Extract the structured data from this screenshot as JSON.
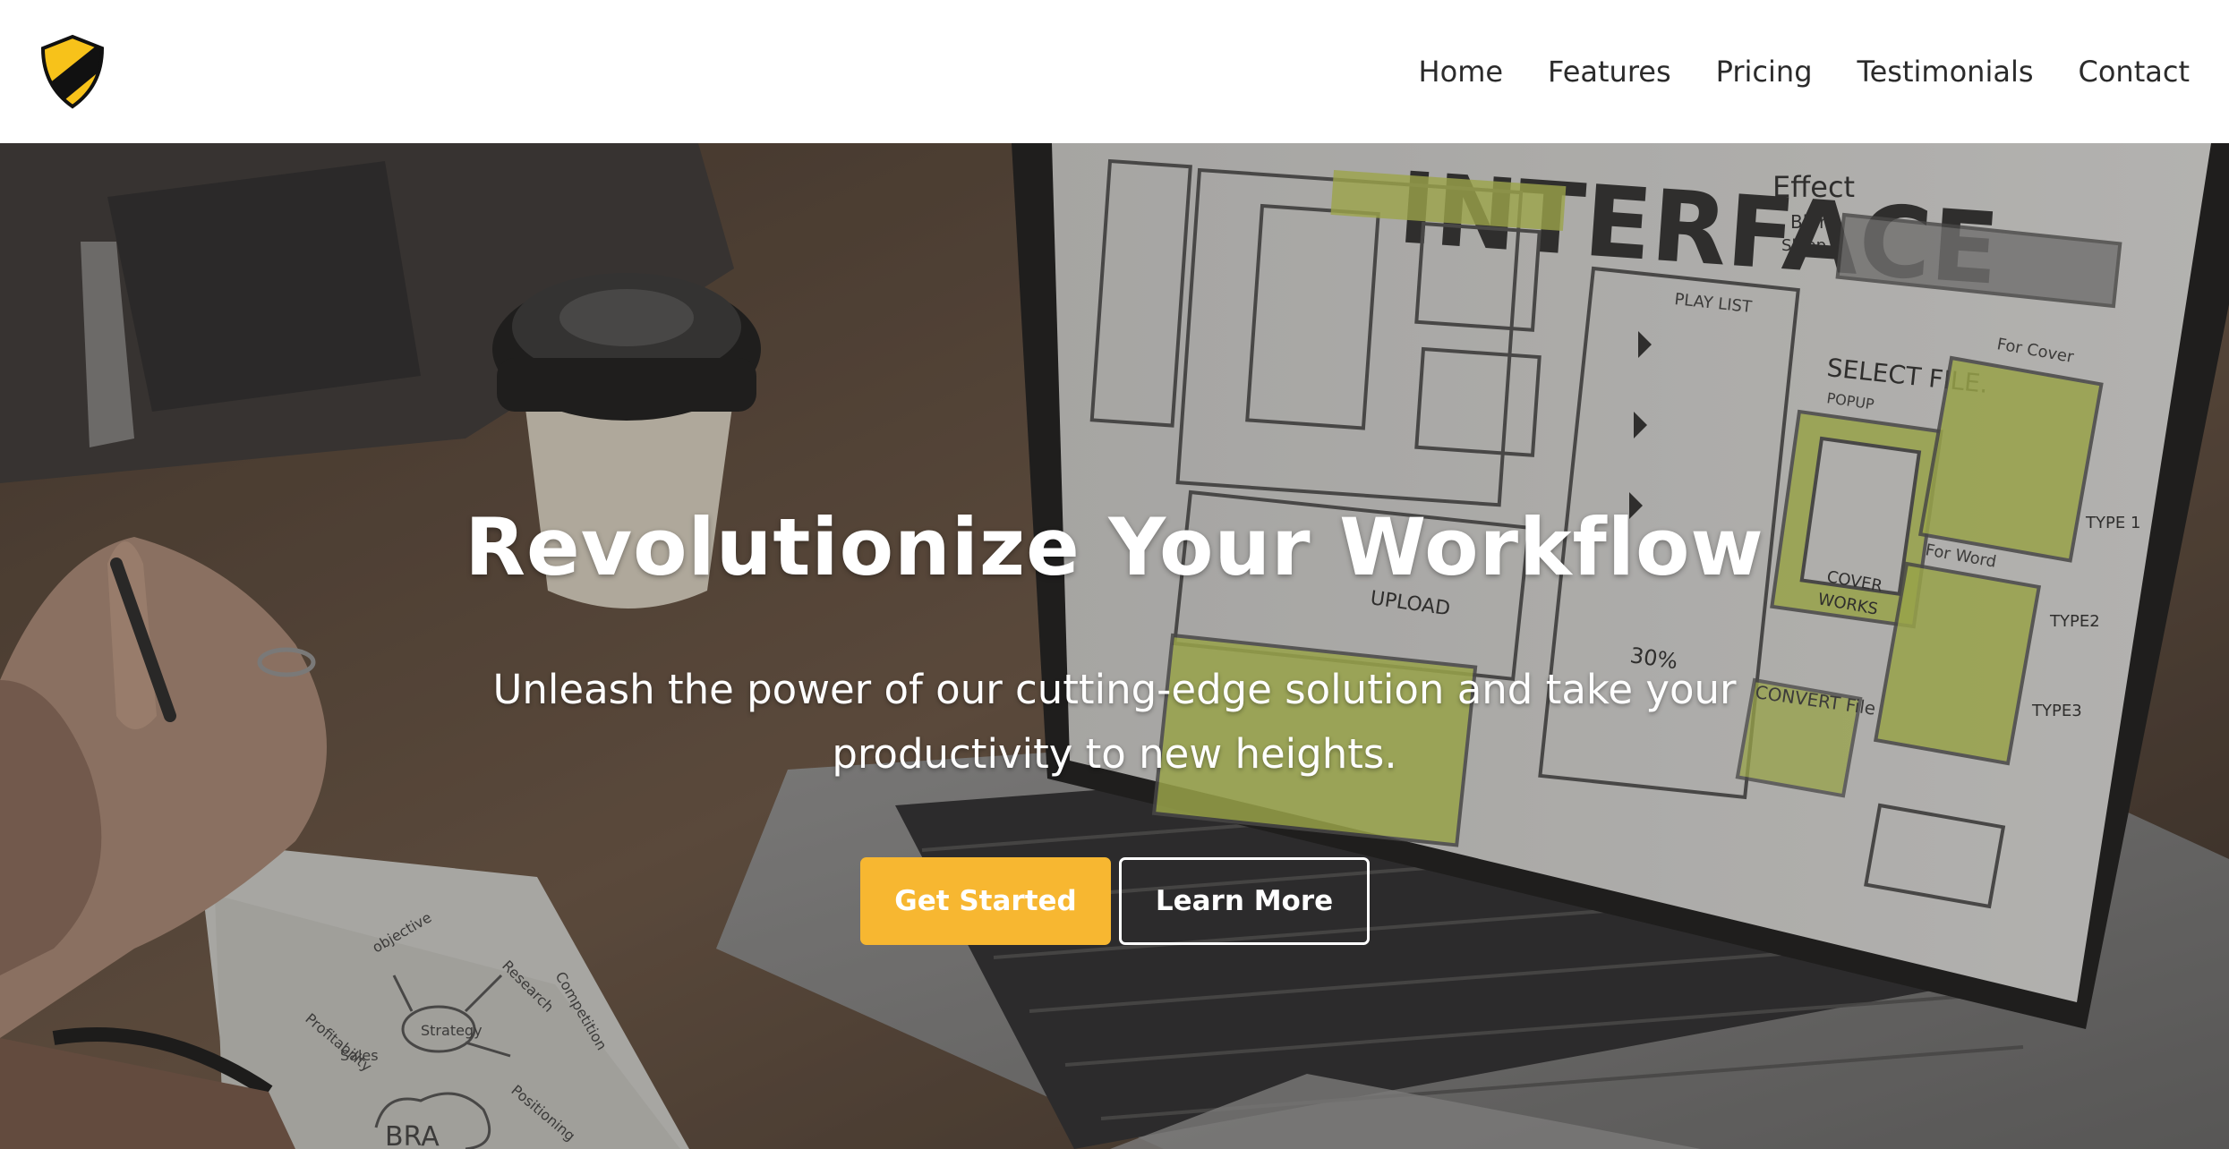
{
  "brand": {
    "logo_icon": "shield-icon",
    "colors": {
      "yellow": "#f7b731",
      "black": "#111111"
    }
  },
  "nav": {
    "items": [
      {
        "label": "Home"
      },
      {
        "label": "Features"
      },
      {
        "label": "Pricing"
      },
      {
        "label": "Testimonials"
      },
      {
        "label": "Contact"
      }
    ]
  },
  "hero": {
    "title": "Revolutionize Your Workflow",
    "subtitle": "Unleash the power of our cutting-edge solution and take your productivity to new heights.",
    "primary_button": "Get Started",
    "secondary_button": "Learn More",
    "accent_color": "#f7b731",
    "background_image": "laptop-ui-sketch-photo",
    "sketch_text": {
      "headline": "INTERFACE",
      "effect": "Effect",
      "blur": "Blur",
      "sleep": "Sleep",
      "playlist": "PLAY LIST",
      "select_file": "SELECT FILE.",
      "popup": "POPUP",
      "for_cover": "For Cover",
      "upload": "UPLOAD",
      "percent": "30%",
      "convert_file": "CONVERT File",
      "type1": "TYPE 1",
      "type2": "TYPE2",
      "type3": "TYPE3",
      "cover": "COVER",
      "works": "WORKS",
      "for_word": "For Word",
      "strategy": "Strategy",
      "objective": "objective",
      "research": "Research",
      "competition": "Competition",
      "profitability": "Profitability",
      "sales": "Sales",
      "positioning": "Positioning",
      "brand": "BRA"
    }
  }
}
